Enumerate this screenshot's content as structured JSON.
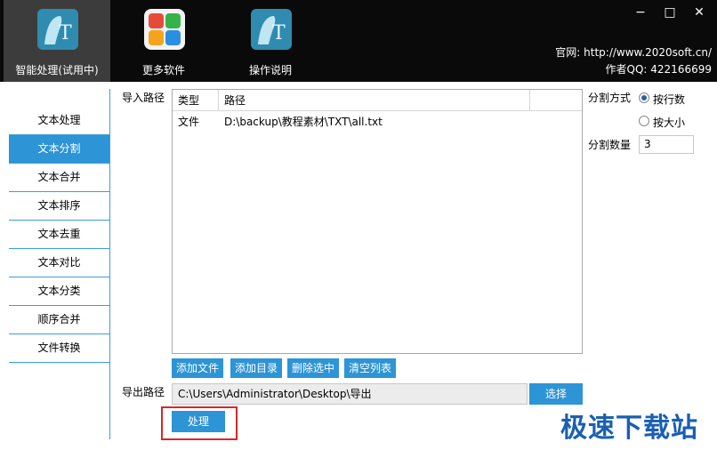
{
  "header": {
    "tools": [
      {
        "label": "智能处理(试用中)",
        "icon": "t-icon"
      },
      {
        "label": "更多软件",
        "icon": "grid-icon"
      },
      {
        "label": "操作说明",
        "icon": "t-icon"
      }
    ],
    "window": {
      "minimize": "−",
      "maximize": "□",
      "close": "✕"
    },
    "site_url": "官网: http://www.2020soft.cn/",
    "author_qq": "作者QQ: 422166699"
  },
  "nav": {
    "items": [
      "文本处理",
      "文本分割",
      "文本合并",
      "文本排序",
      "文本去重",
      "文本对比",
      "文本分类",
      "顺序合并",
      "文件转换"
    ],
    "active_index": 1
  },
  "import": {
    "label": "导入路径",
    "columns": [
      "类型",
      "路径"
    ],
    "rows": [
      {
        "type": "文件",
        "path": "D:\\backup\\教程素材\\TXT\\all.txt"
      }
    ],
    "buttons": {
      "add_file": "添加文件",
      "add_dir": "添加目录",
      "delete_selected": "删除选中",
      "clear_list": "清空列表"
    }
  },
  "export": {
    "label": "导出路径",
    "value": "C:\\Users\\Administrator\\Desktop\\导出",
    "choose": "选择"
  },
  "process_label": "处理",
  "split": {
    "mode_label": "分割方式",
    "by_lines": "按行数",
    "by_size": "按大小",
    "count_label": "分割数量",
    "count_value": "3"
  },
  "watermark": "极速下载站",
  "colors": {
    "accent": "#2d94d6",
    "header": "#0a0a0a",
    "highlight": "#d9262b"
  }
}
